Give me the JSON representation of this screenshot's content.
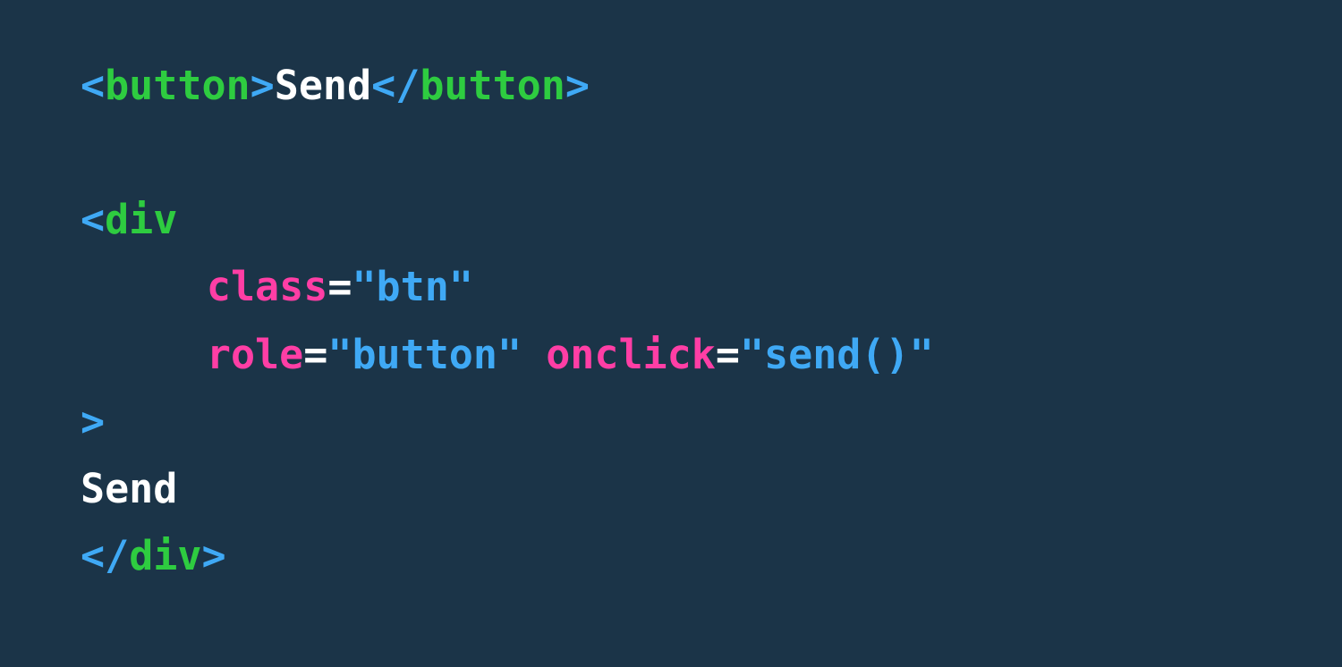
{
  "code": {
    "line1": {
      "open_angle": "<",
      "tag": "button",
      "close_angle": ">",
      "text": "Send",
      "open_angle2": "<",
      "slash": "/",
      "tag2": "button",
      "close_angle2": ">"
    },
    "blank": "",
    "line3": {
      "open_angle": "<",
      "tag": "div"
    },
    "line4": {
      "attr": "class",
      "eq": "=",
      "q1": "\"",
      "val": "btn",
      "q2": "\""
    },
    "line5": {
      "attr1": "role",
      "eq1": "=",
      "q1a": "\"",
      "val1": "button",
      "q1b": "\"",
      "space": " ",
      "attr2": "onclick",
      "eq2": "=",
      "q2a": "\"",
      "val2": "send()",
      "q2b": "\""
    },
    "line6": {
      "close_angle": ">"
    },
    "line7": {
      "text": "Send"
    },
    "line8": {
      "open_angle": "<",
      "slash": "/",
      "tag": "div",
      "close_angle": ">"
    }
  }
}
